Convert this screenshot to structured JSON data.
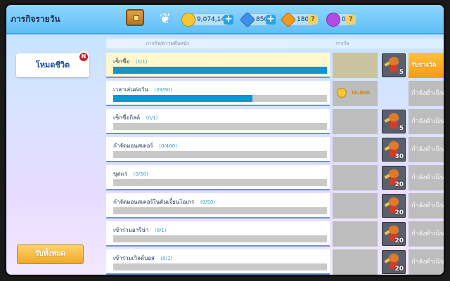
{
  "header": {
    "title": "ภารกิจรายวัน",
    "resources": [
      {
        "icon": "gold-coin-icon",
        "value": "9,074,141",
        "color": "#f5c733",
        "action": "plus"
      },
      {
        "icon": "blue-gem-icon",
        "value": "850",
        "color": "#3b8ff0",
        "action": "plus"
      },
      {
        "icon": "orange-gem-icon",
        "value": "180",
        "color": "#f39a1c",
        "action": "question"
      },
      {
        "icon": "purple-gem-icon",
        "value": "0",
        "color": "#b24ae6",
        "action": "question"
      }
    ]
  },
  "sidebar": {
    "tab_label": "โหมดชีวิต",
    "badge": "N",
    "claim_all": "รับทั้งหมด"
  },
  "columns": {
    "mission": "ภารกิจ/ความคืบหน้า",
    "reward": "รางวัล"
  },
  "missions": [
    {
      "label": "เช็กชื่อ",
      "progress": "(1/1)",
      "fill_percent": 100,
      "reward_text": "",
      "char_level": "5",
      "action": "รับรางวัล",
      "active": true
    },
    {
      "label": "เวลาเล่นต่อวัน",
      "progress": "(39/60)",
      "fill_percent": 65,
      "reward_text": "10,000",
      "char_level": "",
      "action": "กำลังดำเนินการ",
      "active": false
    },
    {
      "label": "เช็กชื่อกิลด์",
      "progress": "(0/1)",
      "fill_percent": 0,
      "reward_text": "",
      "char_level": "5",
      "action": "กำลังดำเนินการ",
      "active": false
    },
    {
      "label": "กำจัดมอนสเตอร์",
      "progress": "(0/400)",
      "fill_percent": 0,
      "reward_text": "",
      "char_level": "30",
      "action": "กำลังดำเนินการ",
      "active": false
    },
    {
      "label": "ขุดแร่",
      "progress": "(0/50)",
      "fill_percent": 0,
      "reward_text": "",
      "char_level": "20",
      "action": "กำลังดำเนินการ",
      "active": false
    },
    {
      "label": "กำจัดมอนสเตอร์ในดันเจี้ยนโอเกร",
      "progress": "(0/50)",
      "fill_percent": 0,
      "reward_text": "",
      "char_level": "20",
      "action": "กำลังดำเนินการ",
      "active": false
    },
    {
      "label": "เข้าร่วมอารีน่า",
      "progress": "(0/1)",
      "fill_percent": 0,
      "reward_text": "",
      "char_level": "20",
      "action": "กำลังดำเนินการ",
      "active": false
    },
    {
      "label": "เข้าร่วมเวิลด์บอส",
      "progress": "(0/1)",
      "fill_percent": 0,
      "reward_text": "",
      "char_level": "20",
      "action": "กำลังดำเนินการ",
      "active": false
    }
  ]
}
